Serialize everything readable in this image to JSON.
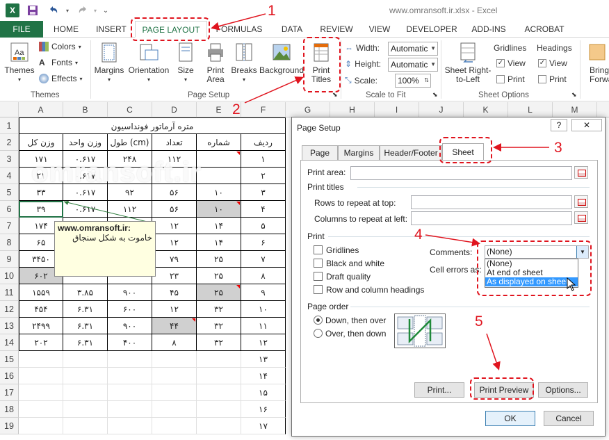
{
  "window": {
    "title": "www.omransoft.ir.xlsx - Excel",
    "app_icon": "excel-icon",
    "quick_access": [
      "save-icon",
      "undo-icon",
      "redo-icon",
      "customize-icon"
    ]
  },
  "tabs": [
    "FILE",
    "HOME",
    "INSERT",
    "PAGE LAYOUT",
    "FORMULAS",
    "DATA",
    "REVIEW",
    "VIEW",
    "DEVELOPER",
    "ADD-INS",
    "ACROBAT"
  ],
  "active_tab": "PAGE LAYOUT",
  "ribbon": {
    "themes": {
      "themes": "Themes",
      "colors": "Colors",
      "fonts": "Fonts",
      "effects": "Effects",
      "group": "Themes"
    },
    "page_setup": {
      "margins": "Margins",
      "orientation": "Orientation",
      "size": "Size",
      "print_area": "Print Area",
      "breaks": "Breaks",
      "background": "Background",
      "print_titles": "Print Titles",
      "group": "Page Setup"
    },
    "scale": {
      "width_label": "Width:",
      "width_value": "Automatic",
      "height_label": "Height:",
      "height_value": "Automatic",
      "scale_label": "Scale:",
      "scale_value": "100%",
      "group": "Scale to Fit"
    },
    "sheet_options": {
      "gridlines": "Gridlines",
      "headings": "Headings",
      "view": "View",
      "print": "Print",
      "sheet_rtl": "Sheet Right-to-Left",
      "group": "Sheet Options"
    },
    "arrange": {
      "bring_forward": "Bring Forward"
    }
  },
  "columns": [
    "A",
    "B",
    "C",
    "D",
    "E",
    "F",
    "G",
    "H",
    "I",
    "J",
    "K",
    "L",
    "M"
  ],
  "rows": [
    "1",
    "2",
    "3",
    "4",
    "5",
    "6",
    "7",
    "8",
    "9",
    "10",
    "11",
    "12",
    "13",
    "14",
    "15",
    "16",
    "17",
    "18",
    "19"
  ],
  "sheet": {
    "title": "متره آرماتور فونداسیون",
    "headers": [
      "وزن کل",
      "وزن واحد",
      "طول (cm)",
      "تعداد",
      "شماره",
      "ردیف"
    ],
    "table_rows": [
      [
        "۱۷۱",
        "۰.۶۱۷",
        "۲۴۸",
        "۱۱۲",
        "",
        "۱"
      ],
      [
        "۲۱",
        "۰.۶۱۷",
        "",
        "",
        "",
        "۲"
      ],
      [
        "۳۳",
        "۰.۶۱۷",
        "۹۲",
        "۵۶",
        "۱۰",
        "۳"
      ],
      [
        "۳۹",
        "۰.۶۱۷",
        "۱۱۲",
        "۵۶",
        "۱۰",
        "۴"
      ],
      [
        "۱۷۴",
        "",
        "",
        "۱۲",
        "۱۴",
        "۵"
      ],
      [
        "۶۵",
        "",
        "",
        "۱۲",
        "۱۴",
        "۶"
      ],
      [
        "۳۴۵۰",
        "",
        "",
        "۷۹",
        "۲۵",
        "۷"
      ],
      [
        "۶۰۲",
        "",
        "",
        "۲۳",
        "۲۵",
        "۸"
      ],
      [
        "۱۵۵۹",
        "۳.۸۵",
        "۹۰۰",
        "۴۵",
        "۲۵",
        "۹"
      ],
      [
        "۴۵۴",
        "۶.۳۱",
        "۶۰۰",
        "۱۲",
        "۳۲",
        "۱۰"
      ],
      [
        "۲۴۹۹",
        "۶.۳۱",
        "۹۰۰",
        "۴۴",
        "۳۲",
        "۱۱"
      ],
      [
        "۲۰۲",
        "۶.۳۱",
        "۴۰۰",
        "۸",
        "۳۲",
        "۱۲"
      ],
      [
        "",
        "",
        "",
        "",
        "",
        "۱۳"
      ],
      [
        "",
        "",
        "",
        "",
        "",
        "۱۴"
      ],
      [
        "",
        "",
        "",
        "",
        "",
        "۱۵"
      ],
      [
        "",
        "",
        "",
        "",
        "",
        "۱۶"
      ],
      [
        "",
        "",
        "",
        "",
        "",
        "۱۷"
      ]
    ]
  },
  "comment": {
    "author": "www.omransoft.ir:",
    "text": "خاموت به شکل سنجاق"
  },
  "watermark": "omransoft.ir",
  "dialog": {
    "title": "Page Setup",
    "help": "?",
    "close": "✕",
    "tabs": [
      "Page",
      "Margins",
      "Header/Footer",
      "Sheet"
    ],
    "active_tab": "Sheet",
    "print_area_label": "Print area:",
    "print_titles_label": "Print titles",
    "rows_label": "Rows to repeat at top:",
    "cols_label": "Columns to repeat at left:",
    "print_label": "Print",
    "gridlines": "Gridlines",
    "black_white": "Black and white",
    "draft": "Draft quality",
    "row_col_headings": "Row and column headings",
    "comments_label": "Comments:",
    "comments_value": "(None)",
    "comments_options": [
      "(None)",
      "At end of sheet",
      "As displayed on sheet"
    ],
    "cell_errors_label": "Cell errors as:",
    "page_order_label": "Page order",
    "down_over": "Down, then over",
    "over_down": "Over, then down",
    "print_btn": "Print...",
    "preview_btn": "Print Preview",
    "options_btn": "Options...",
    "ok": "OK",
    "cancel": "Cancel"
  },
  "annotations": [
    "1",
    "2",
    "3",
    "4",
    "5"
  ],
  "colors": {
    "excel_green": "#217346",
    "annotation_red": "#e0141e",
    "highlight": "#3399ff"
  }
}
